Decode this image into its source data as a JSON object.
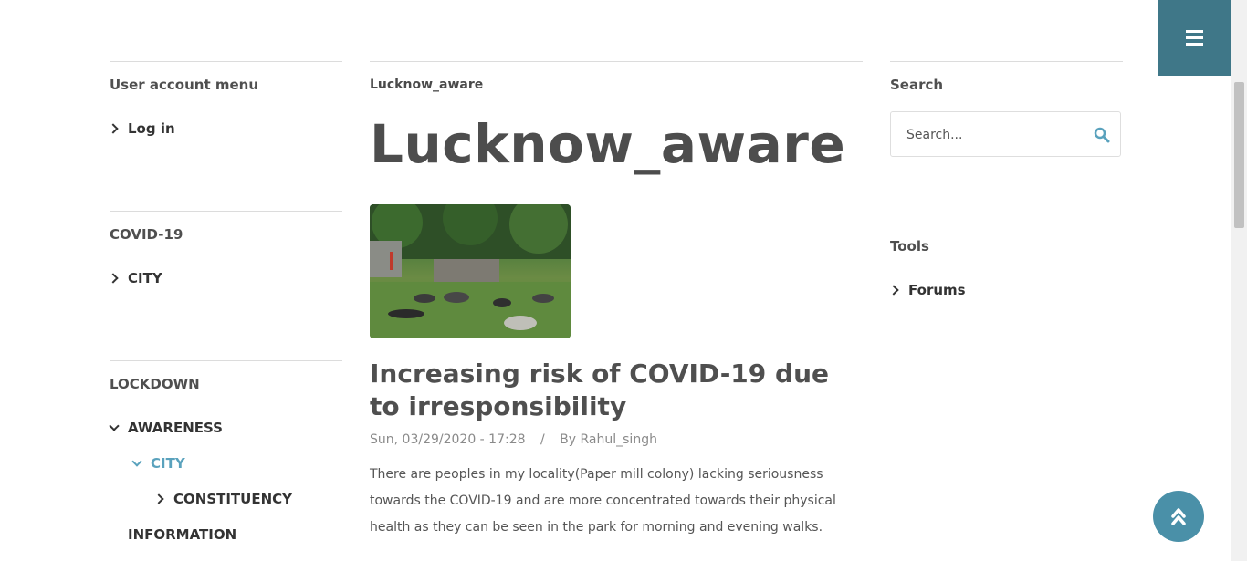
{
  "left": {
    "user_menu": {
      "title": "User account menu",
      "items": [
        "Log in"
      ]
    },
    "covid": {
      "title": "COVID-19",
      "items": [
        "CITY"
      ]
    },
    "lockdown": {
      "title": "LOCKDOWN",
      "awareness": "AWARENESS",
      "city": "CITY",
      "constituency": "CONSTITUENCY",
      "information": "INFORMATION"
    }
  },
  "main": {
    "breadcrumb": "Lucknow_aware",
    "title": "Lucknow_aware",
    "article": {
      "title": "Increasing risk of COVID-19 due to irresponsibility",
      "date": "Sun, 03/29/2020 - 17:28",
      "separator": "/",
      "author": "By Rahul_singh",
      "body": "There are peoples in my locality(Paper mill colony) lacking seriousness towards the COVID-19 and are more concentrated towards their physical health as they can be seen in the park for morning and evening walks."
    }
  },
  "right": {
    "search": {
      "title": "Search",
      "placeholder": "Search..."
    },
    "tools": {
      "title": "Tools",
      "items": [
        "Forums"
      ]
    }
  },
  "colors": {
    "accent": "#3f7788",
    "scroll_top": "#4a90a8",
    "link_active": "#5aa2bd"
  },
  "icons": {
    "menu": "hamburger-icon",
    "search": "search-icon",
    "scroll_top": "double-chevron-up-icon"
  }
}
